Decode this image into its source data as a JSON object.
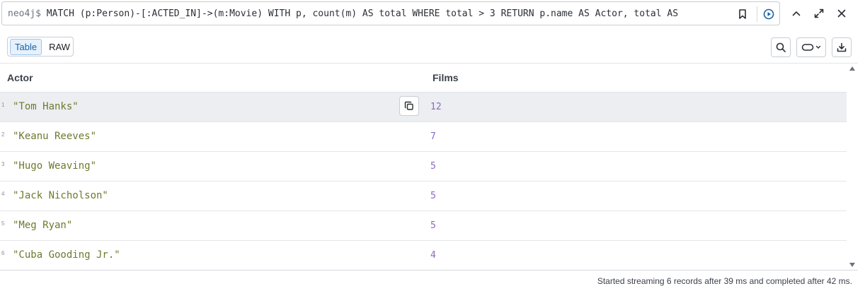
{
  "query": {
    "prompt": "neo4j$",
    "text": "MATCH (p:Person)-[:ACTED_IN]->(m:Movie) WITH p, count(m) AS total WHERE total > 3 RETURN p.name AS Actor, total AS"
  },
  "icons": {
    "bookmark": "bookmark-icon",
    "run": "play-icon",
    "collapse": "chevron-up-icon",
    "expand": "expand-icon",
    "close": "close-icon",
    "search": "search-icon",
    "style": "style-icon",
    "download": "download-icon",
    "copy": "copy-icon"
  },
  "view_toggle": {
    "table_label": "Table",
    "raw_label": "RAW",
    "active": "Table"
  },
  "table": {
    "columns": [
      "Actor",
      "Films"
    ],
    "rows": [
      {
        "index": "1",
        "actor": "\"Tom Hanks\"",
        "films": "12"
      },
      {
        "index": "2",
        "actor": "\"Keanu Reeves\"",
        "films": "7"
      },
      {
        "index": "3",
        "actor": "\"Hugo Weaving\"",
        "films": "5"
      },
      {
        "index": "4",
        "actor": "\"Jack Nicholson\"",
        "films": "5"
      },
      {
        "index": "5",
        "actor": "\"Meg Ryan\"",
        "films": "5"
      },
      {
        "index": "6",
        "actor": "\"Cuba Gooding Jr.\"",
        "films": "4"
      }
    ]
  },
  "status": "Started streaming 6 records after 39 ms and completed after 42 ms.",
  "colors": {
    "string_value": "#6d7a2e",
    "number_value": "#8b6bbf",
    "accent": "#1b63a5",
    "row_hover": "#eceef1"
  }
}
